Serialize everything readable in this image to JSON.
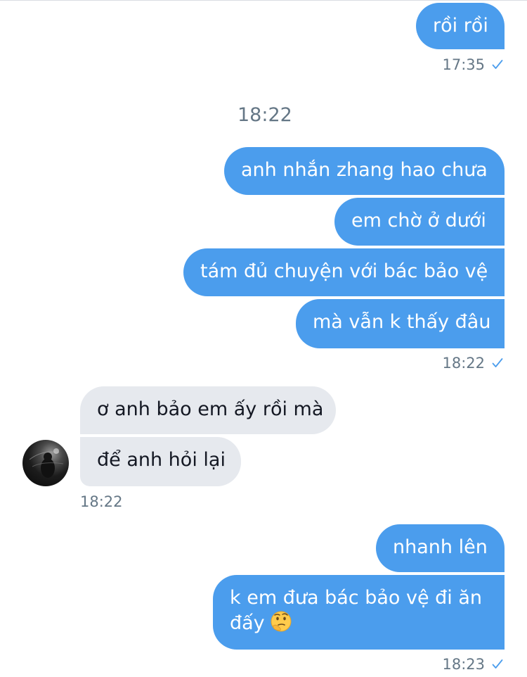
{
  "colors": {
    "outgoing_bubble": "#4b9ded",
    "incoming_bubble": "#e6e9ee",
    "timestamp_text": "#657786",
    "check_mark": "#4b9ded"
  },
  "messages": {
    "m1": {
      "text": "rồi rồi",
      "time": "17:35"
    },
    "divider_time": "18:22",
    "group2": {
      "m1": "anh nhắn zhang hao chưa",
      "m2": "em chờ ở dưới",
      "m3": "tám đủ chuyện với bác bảo vệ",
      "m4": "mà vẫn k thấy đâu",
      "time": "18:22"
    },
    "incoming": {
      "m1": "ơ anh bảo em ấy rồi mà",
      "m2": "để anh hỏi lại",
      "time": "18:22"
    },
    "group3": {
      "m1": "nhanh lên",
      "m2": "k em đưa bác bảo vệ đi ăn đấy",
      "emoji": "thinking-face",
      "time": "18:23"
    }
  },
  "icons": {
    "sent": "check-icon",
    "avatar": "contact-avatar"
  }
}
